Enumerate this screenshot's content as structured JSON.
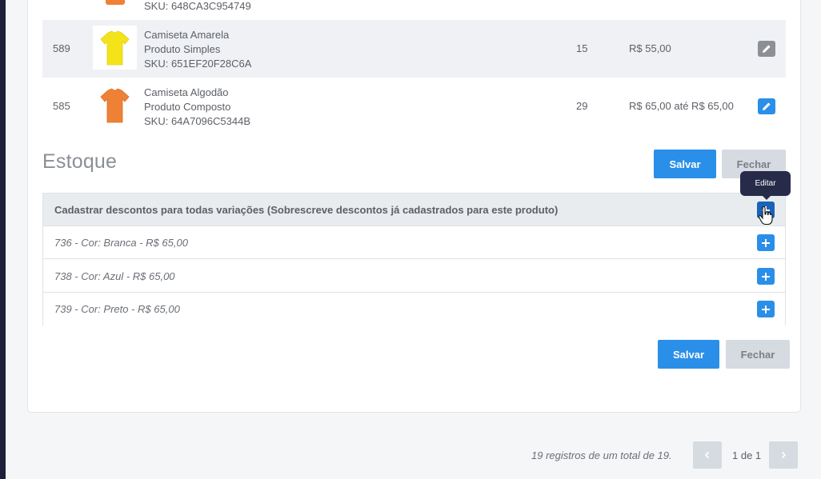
{
  "products": {
    "cut_row": {
      "sku": "SKU: 648CA3C954749"
    },
    "rows": [
      {
        "id": "589",
        "name": "Camiseta Amarela",
        "type": "Produto Simples",
        "sku": "SKU: 651EF20F28C6A",
        "qty": "15",
        "price": "R$ 55,00",
        "shirt_color": "#f5e31a",
        "edit_color": "#8c9096"
      },
      {
        "id": "585",
        "name": "Camiseta Algodão",
        "type": "Produto Composto",
        "sku": "SKU: 64A7096C5344B",
        "qty": "29",
        "price": "R$ 65,00 até R$ 65,00",
        "shirt_color": "#ef8136",
        "edit_color": "#2a8fe8"
      }
    ]
  },
  "stock": {
    "title": "Estoque",
    "save_label": "Salvar",
    "close_label": "Fechar"
  },
  "discounts": {
    "header": "Cadastrar descontos para todas variações (Sobrescreve descontos já cadastrados para este produto)",
    "rows": [
      "736 - Cor: Branca - R$ 65,00",
      "738 - Cor: Azul - R$ 65,00",
      "739 - Cor: Preto - R$ 65,00"
    ],
    "tooltip": "Editar"
  },
  "bottom_actions": {
    "save_label": "Salvar",
    "close_label": "Fechar"
  },
  "pagination": {
    "info": "19 registros de um total de 19.",
    "page": "1 de 1",
    "prev_icon": "chevron-left-icon",
    "next_icon": "chevron-right-icon"
  }
}
